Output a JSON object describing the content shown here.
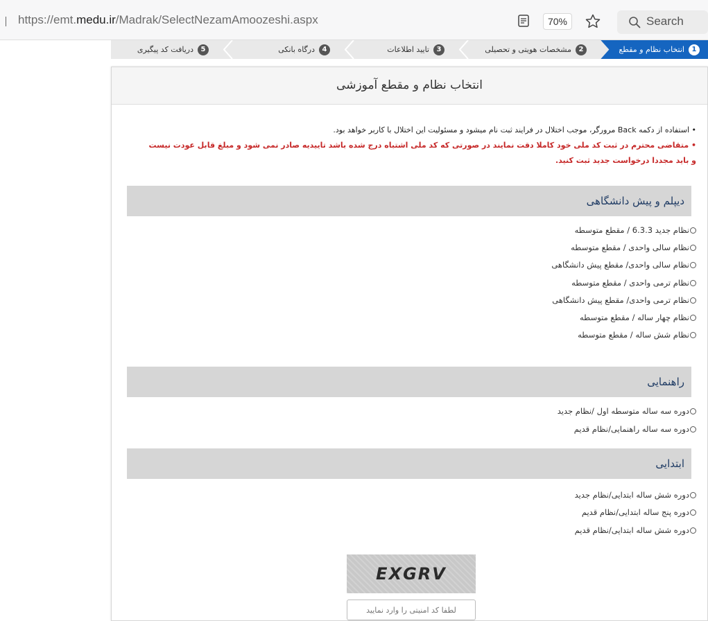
{
  "browser": {
    "url_prefix": "https://emt.",
    "url_domain": "medu.ir",
    "url_path": "/Madrak/SelectNezamAmoozeshi.aspx",
    "zoom": "70%",
    "search_label": "Search"
  },
  "steps": [
    {
      "num": "1",
      "label": "انتخاب نظام و مقطع"
    },
    {
      "num": "2",
      "label": "مشخصات هویتی و تحصیلی"
    },
    {
      "num": "3",
      "label": "تایید اطلاعات"
    },
    {
      "num": "4",
      "label": "درگاه بانکی"
    },
    {
      "num": "5",
      "label": "دریافت کد پیگیری"
    }
  ],
  "card": {
    "title": "انتخاب نظام و مقطع آموزشی",
    "notice_1": "• استفاده از دکمه Back مرورگر، موجب اختلال در فرایند ثبت نام میشود و مسئولیت این اختلال با کاربر خواهد بود.",
    "notice_2_line1": "• متقاضی محترم در ثبت کد ملی خود کاملا دقت نمایند در صورتی که کد ملی اشتباه درج شده باشد تاییدیه صادر نمی شود و مبلغ قابل عودت نیست",
    "notice_2_line2": "و باید مجددا درخواست جدید ثبت کنید."
  },
  "sections": {
    "diploma": {
      "title": "دیپلم و پیش دانشگاهی",
      "options": [
        "نظام جدید 6.3.3 / مقطع متوسطه",
        "نظام سالی واحدی / مقطع متوسطه",
        "نظام سالی واحدی/ مقطع پیش دانشگاهی",
        "نظام ترمی واحدی / مقطع متوسطه",
        "نظام ترمی واحدی/ مقطع پیش دانشگاهی",
        "نظام چهار ساله / مقطع متوسطه",
        "نظام شش ساله / مقطع متوسطه"
      ]
    },
    "guidance": {
      "title": "راهنمایی",
      "options": [
        "دوره سه ساله متوسطه اول /نظام جدید",
        "دوره سه ساله راهنمایی/نظام قدیم"
      ]
    },
    "primary": {
      "title": "ابتدایی",
      "options": [
        "دوره شش ساله ابتدایی/نظام جدید",
        "دوره پنج ساله ابتدایی/نظام قدیم",
        "دوره شش ساله ابتدایی/نظام قدیم"
      ]
    }
  },
  "captcha": {
    "code": "EXGRV",
    "input_placeholder": "لطفا کد امنیتی را وارد نمایید"
  }
}
